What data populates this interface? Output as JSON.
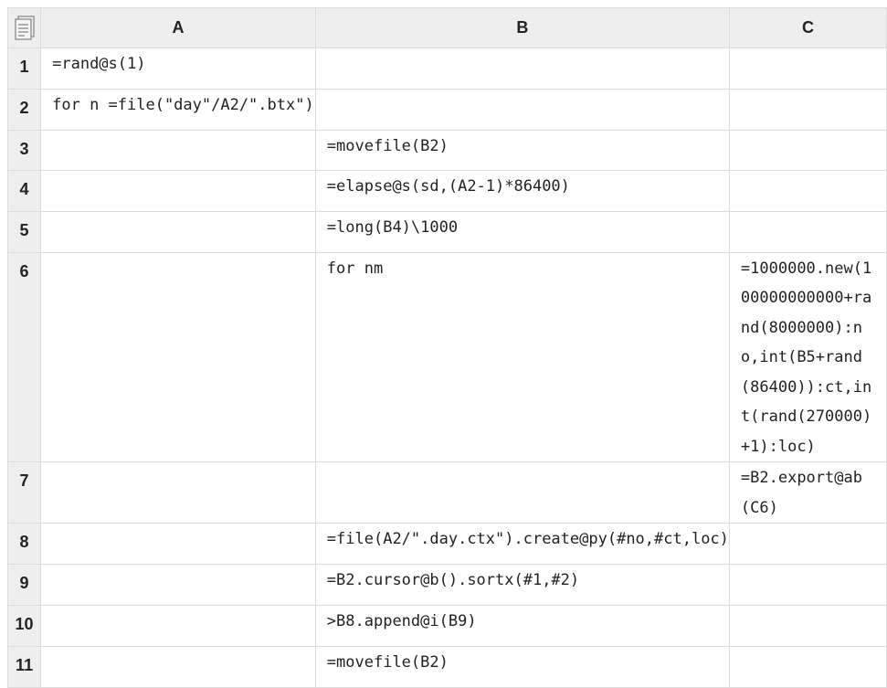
{
  "columns": [
    "A",
    "B",
    "C"
  ],
  "rows": [
    {
      "num": "1",
      "A": "=rand@s(1)",
      "B": "",
      "C": ""
    },
    {
      "num": "2",
      "A": "for n =file(\"day\"/A2/\".btx\")",
      "B": "",
      "C": ""
    },
    {
      "num": "3",
      "A": "",
      "B": "=movefile(B2)",
      "C": ""
    },
    {
      "num": "4",
      "A": "",
      "B": "=elapse@s(sd,(A2-1)*86400)",
      "C": ""
    },
    {
      "num": "5",
      "A": "",
      "B": "=long(B4)\\1000",
      "C": ""
    },
    {
      "num": "6",
      "A": "",
      "B": "for nm",
      "C": "=1000000.new(100000000000+rand(8000000):no,int(B5+rand(86400)):ct,int(rand(270000)+1):loc)"
    },
    {
      "num": "7",
      "A": "",
      "B": "",
      "C": "=B2.export@ab(C6)"
    },
    {
      "num": "8",
      "A": "",
      "B": "=file(A2/\".day.ctx\").create@py(#no,#ct,loc)",
      "C": ""
    },
    {
      "num": "9",
      "A": "",
      "B": "=B2.cursor@b().sortx(#1,#2)",
      "C": ""
    },
    {
      "num": "10",
      "A": "",
      "B": ">B8.append@i(B9)",
      "C": ""
    },
    {
      "num": "11",
      "A": "",
      "B": "=movefile(B2)",
      "C": ""
    }
  ],
  "icons": {
    "corner": "sheet-menu-icon"
  }
}
